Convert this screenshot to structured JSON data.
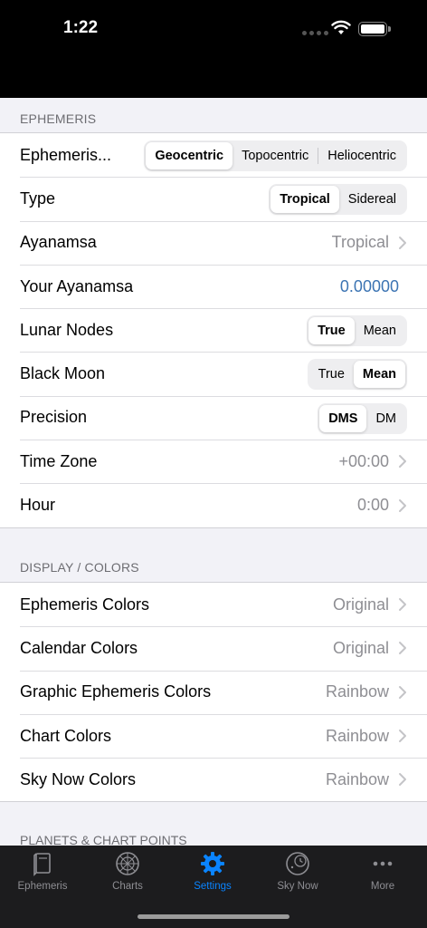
{
  "status_bar": {
    "time": "1:22"
  },
  "ephemeris_section": {
    "header": "EPHEMERIS",
    "rows": [
      {
        "label": "Ephemeris...",
        "segments": [
          "Geocentric",
          "Topocentric",
          "Heliocentric"
        ],
        "selected": "Geocentric"
      },
      {
        "label": "Type",
        "segments": [
          "Tropical",
          "Sidereal"
        ],
        "selected": "Tropical"
      },
      {
        "label": "Ayanamsa",
        "value": "Tropical"
      },
      {
        "label": "Your Ayanamsa",
        "value": "0.00000"
      },
      {
        "label": "Lunar Nodes",
        "segments": [
          "True",
          "Mean"
        ],
        "selected": "True"
      },
      {
        "label": "Black Moon",
        "segments": [
          "True",
          "Mean"
        ],
        "selected": "Mean"
      },
      {
        "label": "Precision",
        "segments": [
          "DMS",
          "DM"
        ],
        "selected": "DMS"
      },
      {
        "label": "Time Zone",
        "value": "+00:00"
      },
      {
        "label": "Hour",
        "value": "0:00"
      }
    ]
  },
  "display_section": {
    "header": "DISPLAY / COLORS",
    "rows": [
      {
        "label": "Ephemeris Colors",
        "value": "Original"
      },
      {
        "label": "Calendar Colors",
        "value": "Original"
      },
      {
        "label": "Graphic Ephemeris Colors",
        "value": "Rainbow"
      },
      {
        "label": "Chart Colors",
        "value": "Rainbow"
      },
      {
        "label": "Sky Now Colors",
        "value": "Rainbow"
      }
    ]
  },
  "next_section_header": "PLANETS & CHART POINTS",
  "tab_bar": {
    "tabs": [
      {
        "label": "Ephemeris",
        "icon": "book-icon"
      },
      {
        "label": "Charts",
        "icon": "chart-wheel-icon"
      },
      {
        "label": "Settings",
        "icon": "gear-icon",
        "active": true
      },
      {
        "label": "Sky Now",
        "icon": "sky-clock-icon"
      },
      {
        "label": "More",
        "icon": "more-dots-icon"
      }
    ],
    "active_color": "#0a84ff",
    "inactive_color": "#8e8e93"
  },
  "colors": {
    "value_blue": "#3c74b3",
    "background": "#f2f2f7"
  }
}
